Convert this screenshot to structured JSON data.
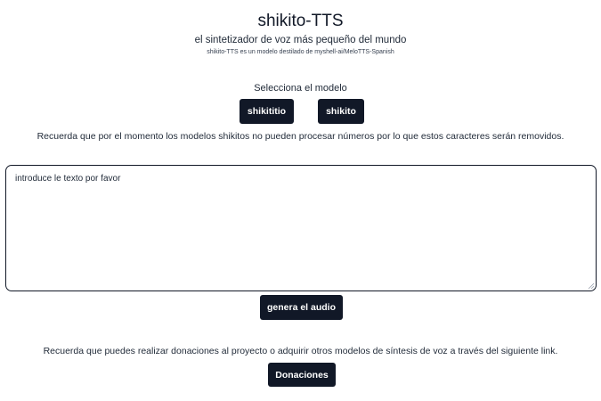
{
  "header": {
    "title": "shikito-TTS",
    "subtitle": "el sintetizador de voz más pequeño del mundo",
    "note": "shikito-TTS es un modelo destilado de myshell-ai/MeloTTS-Spanish"
  },
  "model_selector": {
    "label": "Selecciona el modelo",
    "options": [
      "shikititio",
      "shikito"
    ]
  },
  "notice_numbers": "Recuerda que por el momento los modelos shikitos no pueden procesar números por lo que estos caracteres serán removidos.",
  "text_input": {
    "placeholder": "introduce le texto por favor",
    "value": ""
  },
  "generate_label": "genera el audio",
  "notice_donations": "Recuerda que puedes realizar donaciones al proyecto o adquirir otros modelos de síntesis de voz a través del siguiente link.",
  "donate_label": "Donaciones",
  "colors": {
    "button_bg": "#111827",
    "button_text": "#ffffff",
    "border": "#111827"
  }
}
